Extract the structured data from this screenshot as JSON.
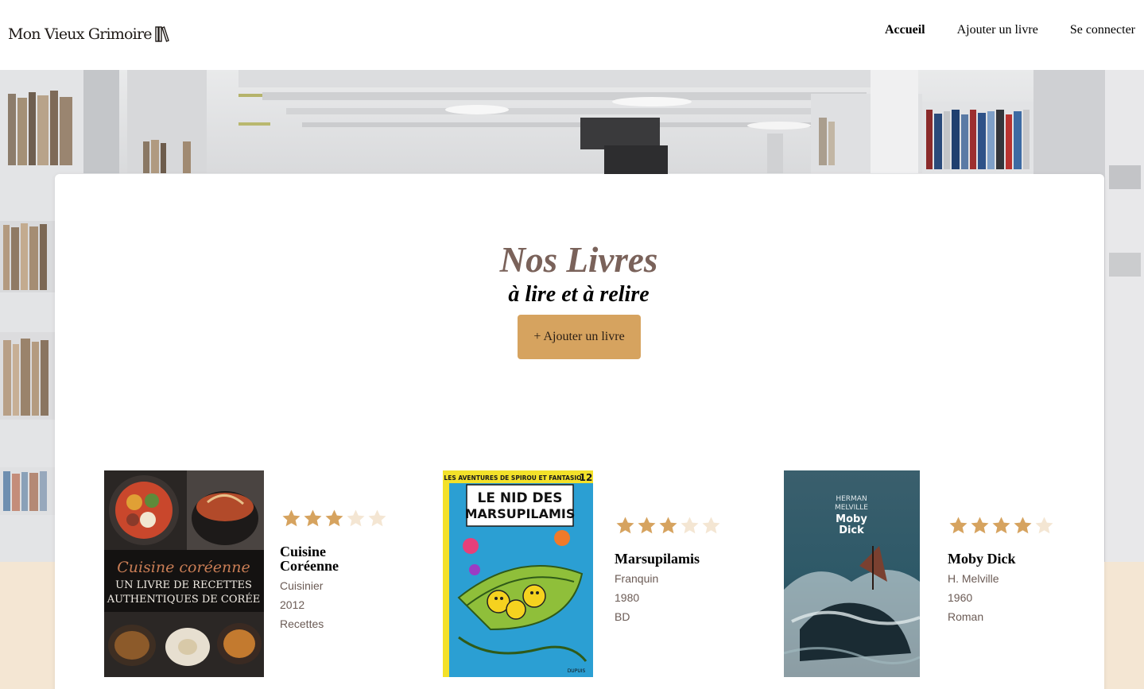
{
  "header": {
    "logo_text": "Mon Vieux Grimoire",
    "nav": [
      {
        "label": "Accueil"
      },
      {
        "label": "Ajouter un livre"
      },
      {
        "label": "Se connecter"
      }
    ]
  },
  "hero": {
    "title": "Nos Livres",
    "subtitle": "à lire et à relire",
    "add_button_label": "+ Ajouter un livre"
  },
  "books": [
    {
      "title": "Cuisine Coréenne",
      "title_lines": [
        "Cuisine",
        "Coréenne"
      ],
      "author": "Cuisinier",
      "year": "2012",
      "genre": "Recettes",
      "rating": 3,
      "cover": {
        "line1": "Cuisine coréenne",
        "line2": "UN LIVRE DE RECETTES",
        "line3": "AUTHENTIQUES DE CORÉE"
      }
    },
    {
      "title": "Marsupilamis",
      "author": "Franquin",
      "year": "1980",
      "genre": "BD",
      "rating": 3,
      "cover": {
        "series": "LES AVENTURES DE SPIROU ET FANTASIO",
        "number": "12",
        "line1": "LE NID DES",
        "line2": "MARSUPILAMIS",
        "publisher": "DUPUIS"
      }
    },
    {
      "title": "Moby Dick",
      "author": "H. Melville",
      "year": "1960",
      "genre": "Roman",
      "rating": 4,
      "cover": {
        "author_line1": "HERMAN",
        "author_line2": "MELVILLE",
        "title_line1": "Moby",
        "title_line2": "Dick"
      }
    }
  ],
  "colors": {
    "accent": "#d6a35f",
    "star_full": "#d6a35f",
    "star_empty": "#f4e6d3",
    "title": "#7a625a",
    "meta": "#6b5b55",
    "beige_band": "#f4e6d3"
  }
}
